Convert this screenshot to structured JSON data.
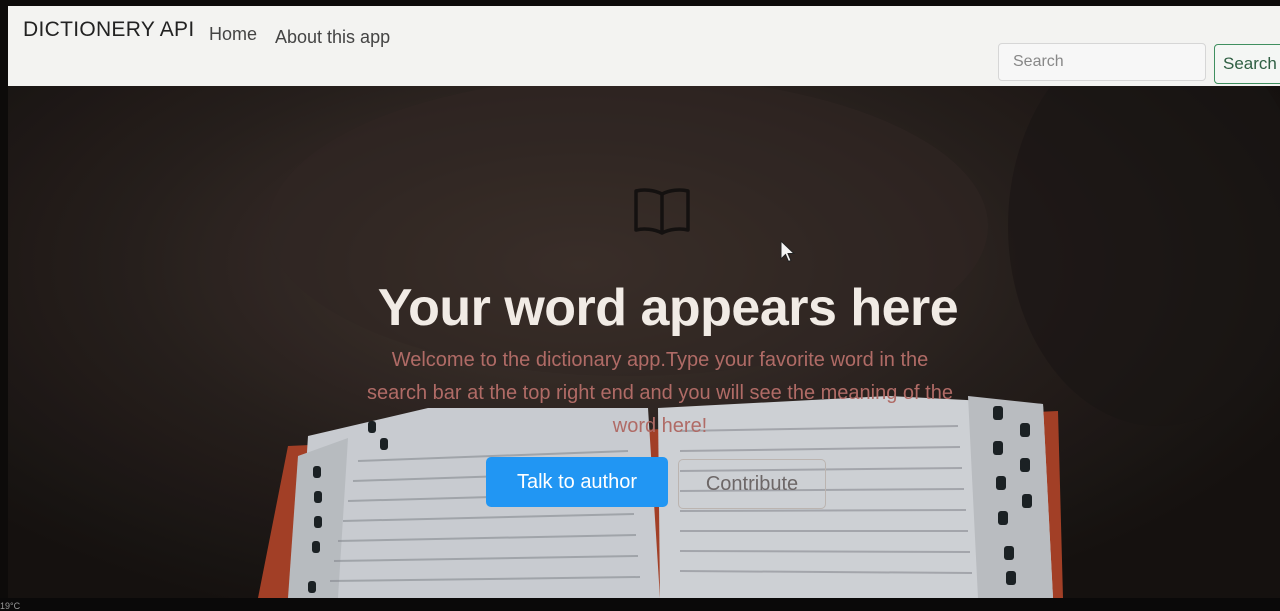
{
  "navbar": {
    "brand": "DICTIONERY API",
    "links": [
      {
        "label": "Home"
      },
      {
        "label": "About this app"
      }
    ],
    "search": {
      "placeholder": "Search",
      "button_label": "Search"
    }
  },
  "hero": {
    "title": "Your word appears here",
    "subtitle": "Welcome to the dictionary app.Type your favorite word in the search bar at the top right end and you will see the meaning of the word here!",
    "primary_button": "Talk to author",
    "secondary_button": "Contribute",
    "icon": "book-open-icon"
  },
  "taskbar": {
    "temperature": "19°C"
  },
  "colors": {
    "navbar_bg": "#f3f3f1",
    "primary_button": "#2196f3",
    "subtitle": "#b06b66",
    "search_button_border": "#3f8f5f"
  }
}
